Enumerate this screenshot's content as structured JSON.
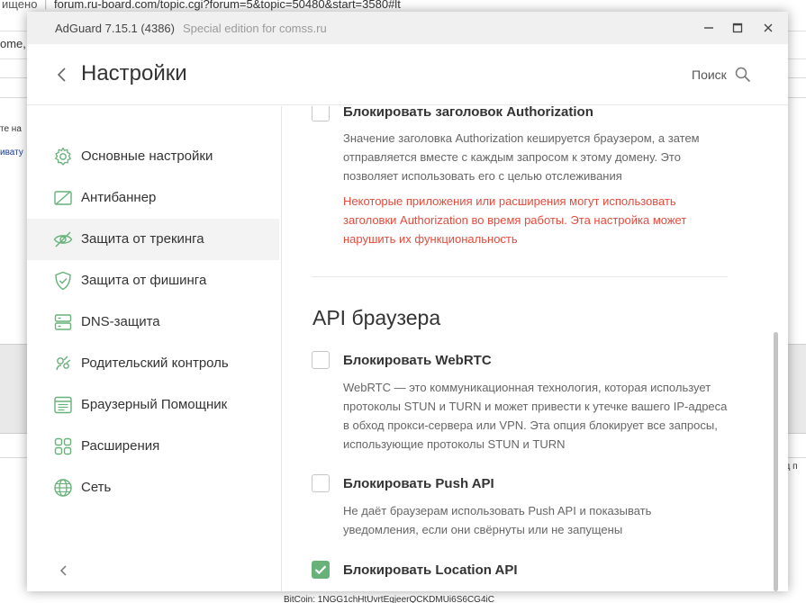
{
  "background": {
    "address_fragment": "ищено",
    "url": "forum.ru-board.com/topic.cgi?forum=5&topic=50480&start=3580#lt",
    "row_fragment": "ome,",
    "left_fragment_1": "те на",
    "left_fragment_2": "ивату",
    "right_fragment": "вод п",
    "bitcoin": "BitCoin: 1NGG1chHtUvrtEqjeerQCKDMUi6S6CG4iC"
  },
  "window": {
    "app_name": "AdGuard 7.15.1 (4386)",
    "edition": "Special edition for comss.ru",
    "controls": {
      "minimize": "minimize-icon",
      "maximize": "maximize-icon",
      "close": "close-icon"
    }
  },
  "header": {
    "title": "Настройки",
    "search_label": "Поиск"
  },
  "sidebar": {
    "items": [
      {
        "label": "Основные настройки",
        "icon": "gear-icon"
      },
      {
        "label": "Антибаннер",
        "icon": "antibanner-icon"
      },
      {
        "label": "Защита от трекинга",
        "icon": "eye-crossed-icon",
        "active": true
      },
      {
        "label": "Защита от фишинга",
        "icon": "shield-icon"
      },
      {
        "label": "DNS-защита",
        "icon": "dns-icon"
      },
      {
        "label": "Родительский контроль",
        "icon": "parental-icon"
      },
      {
        "label": "Браузерный Помощник",
        "icon": "browser-icon"
      },
      {
        "label": "Расширения",
        "icon": "extensions-icon"
      },
      {
        "label": "Сеть",
        "icon": "globe-icon"
      }
    ]
  },
  "content": {
    "authorization": {
      "title": "Блокировать заголовок Authorization",
      "checked": false,
      "description": "Значение заголовка Authorization кешируется браузером, а затем отправляется вместе с каждым запросом к этому домену. Это позволяет использовать его с целью отслеживания",
      "warning": "Некоторые приложения или расширения могут использовать заголовки Authorization во время работы. Эта настройка может нарушить их функциональность"
    },
    "api_section_title": "API браузера",
    "webrtc": {
      "title": "Блокировать WebRTC",
      "checked": false,
      "description": "WebRTC — это коммуникационная технология, которая использует протоколы STUN и TURN и может привести к утечке вашего IP-адреса в обход прокси-сервера или VPN. Эта опция блокирует все запросы, использующие протоколы STUN и TURN"
    },
    "push": {
      "title": "Блокировать Push API",
      "checked": false,
      "description": "Не даёт браузерам использовать Push API и показывать уведомления, если они свёрнуты или не запущены"
    },
    "location": {
      "title": "Блокировать Location API",
      "checked": true
    }
  },
  "colors": {
    "accent": "#67b279",
    "warning": "#e54a3b",
    "icon": "#67b279"
  }
}
